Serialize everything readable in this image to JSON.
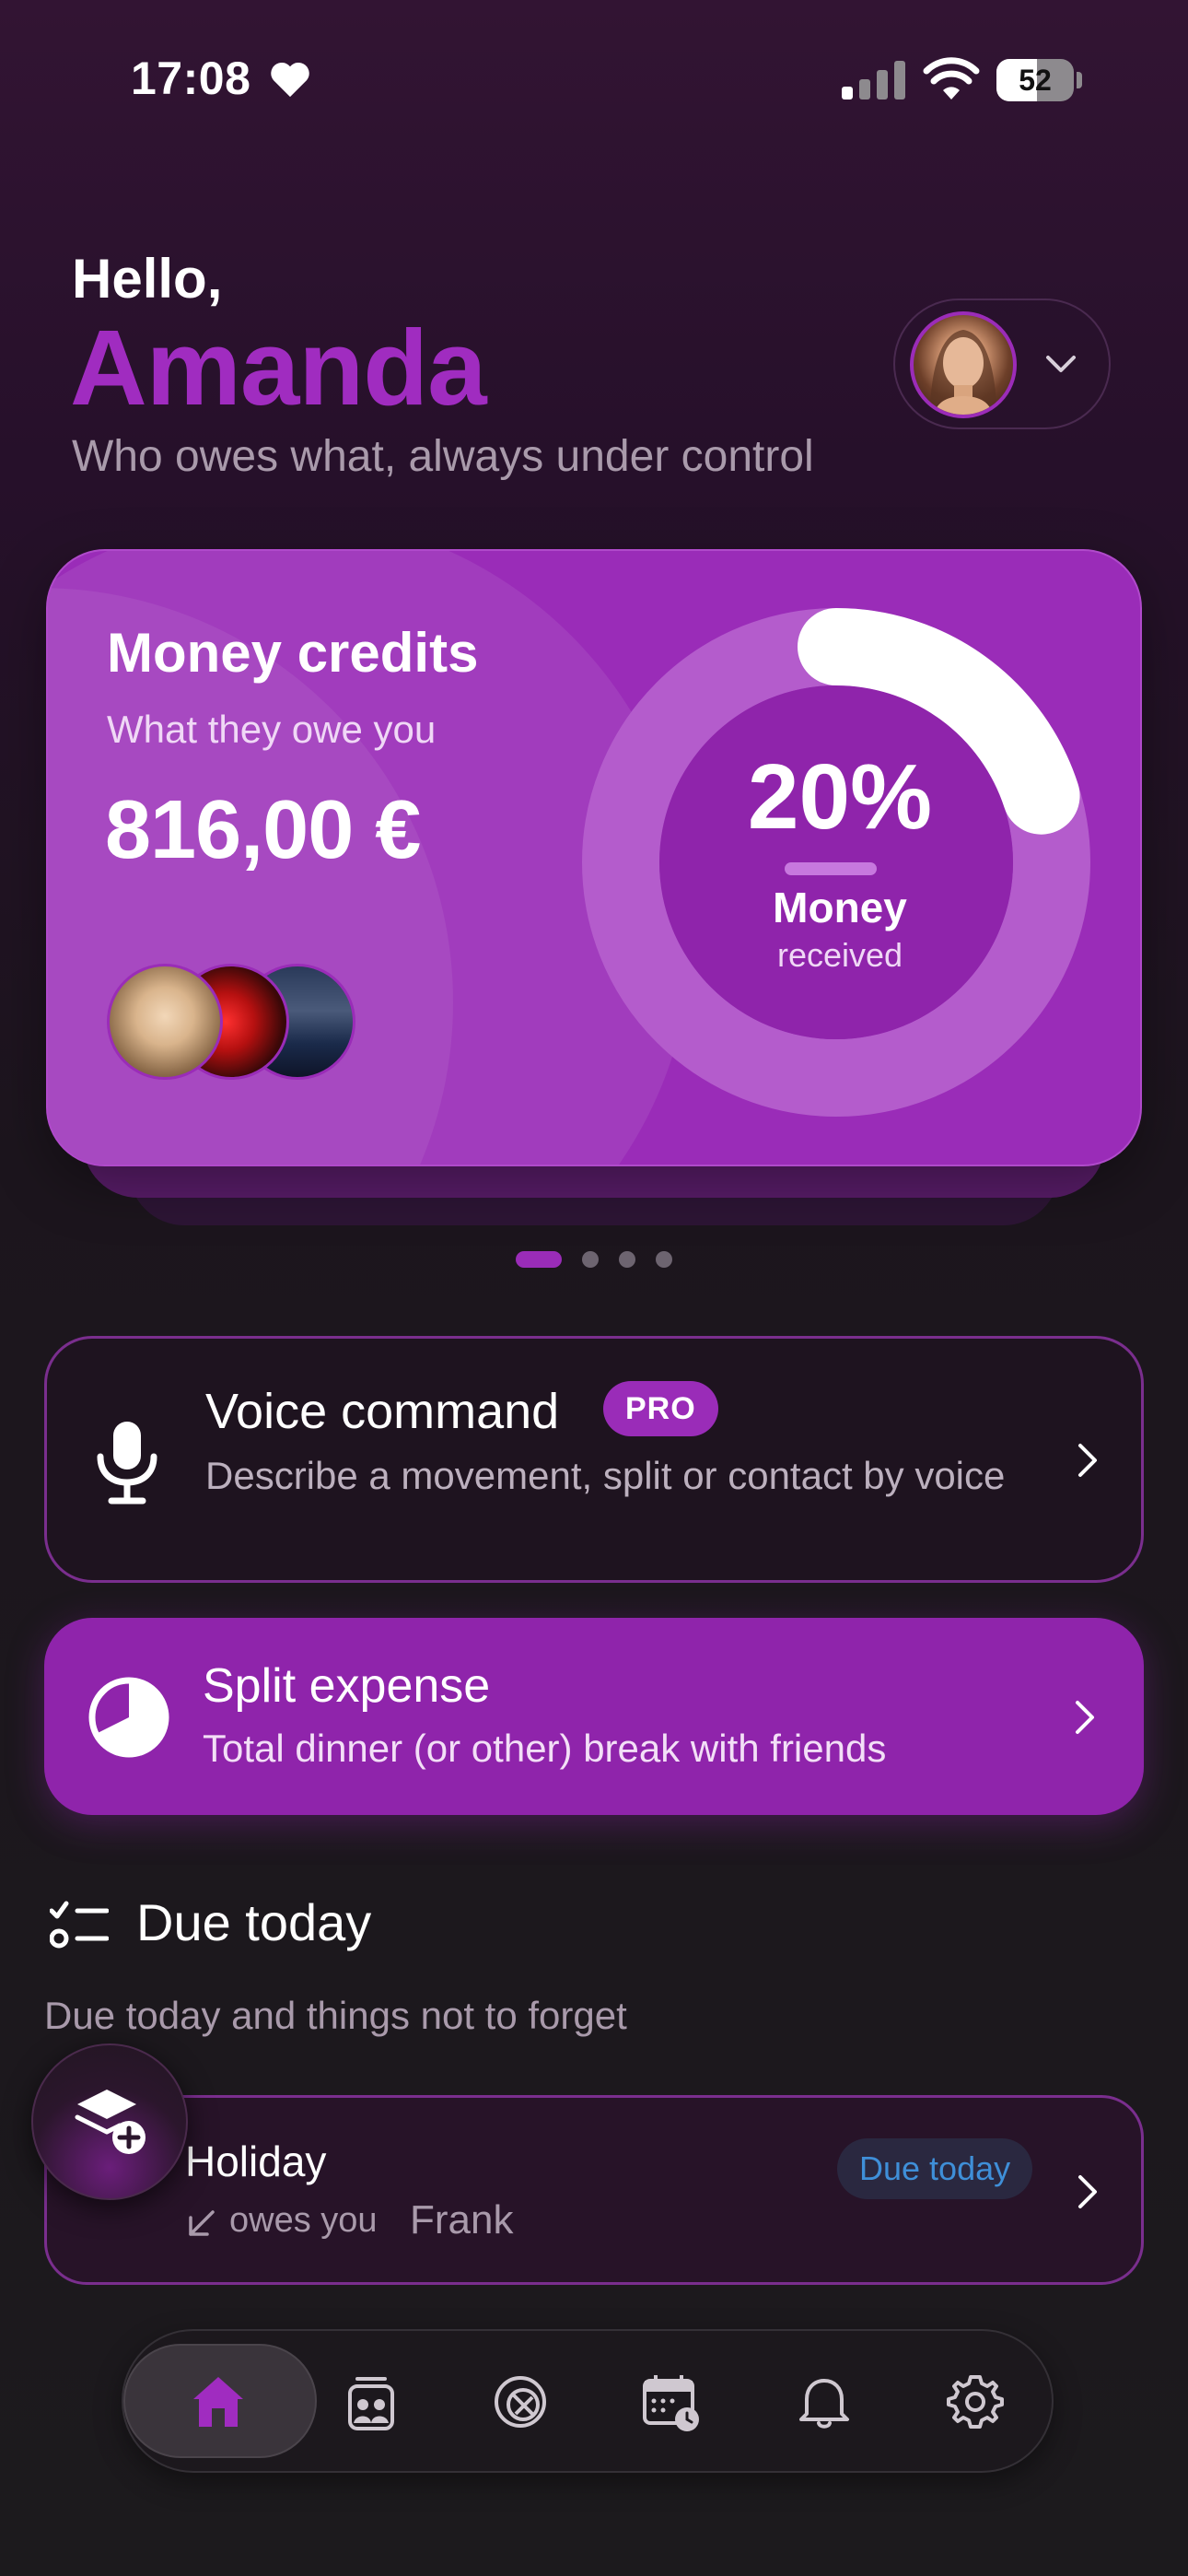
{
  "status_bar": {
    "time": "17:08",
    "battery_percent": 52,
    "battery_label": "52"
  },
  "header": {
    "greeting": "Hello,",
    "user_name": "Amanda",
    "tagline": "Who owes what, always under control"
  },
  "credits_card": {
    "title": "Money credits",
    "subtitle": "What they owe you",
    "amount": "816,00 €",
    "progress_fraction": 0.2,
    "progress_text": "20%",
    "progress_label": "Money",
    "progress_sublabel": "received",
    "avatars": [
      "contact-avatar-1",
      "contact-avatar-2",
      "contact-avatar-3"
    ]
  },
  "pager": {
    "total": 4,
    "active": 0
  },
  "voice_command": {
    "title": "Voice command",
    "badge": "PRO",
    "description": "Describe a movement, split or contact by voice"
  },
  "split_expense": {
    "title": "Split expense",
    "description": "Total dinner (or other) break with friends"
  },
  "due_today": {
    "title": "Due today",
    "subtitle": "Due today and things not to forget",
    "items": [
      {
        "title": "Holiday",
        "direction": "owes you",
        "contact": "Frank",
        "badge": "Due today"
      }
    ]
  },
  "bottom_nav": {
    "items": [
      "home-icon",
      "contacts-icon",
      "split-icon",
      "calendar-icon",
      "bell-icon",
      "gear-icon"
    ],
    "active": "home-icon"
  },
  "colors": {
    "accent": "#9a2cb8",
    "name_purple": "#a02cc0",
    "badge_blue": "#3f8fd8",
    "background": "#1c1a1d"
  }
}
